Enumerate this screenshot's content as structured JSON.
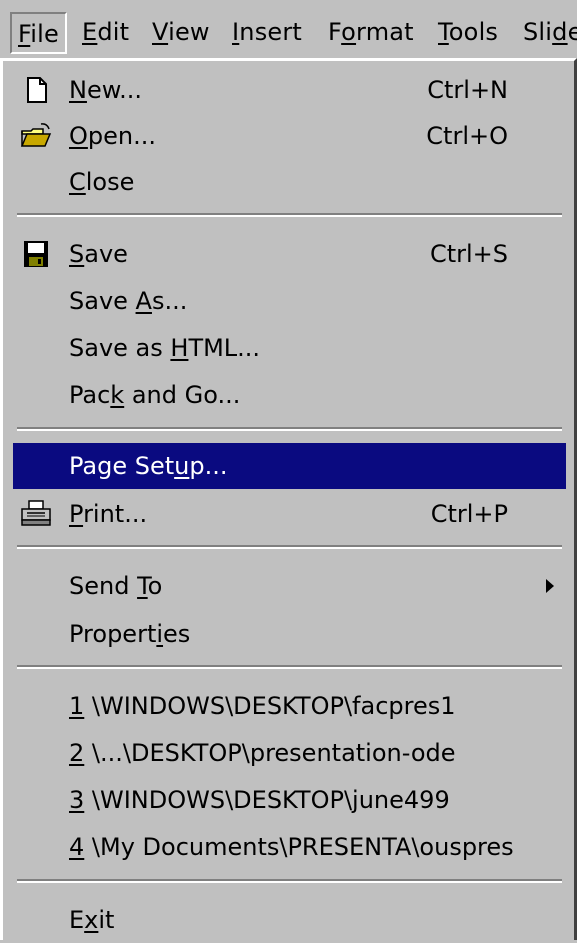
{
  "menubar": {
    "items": [
      {
        "pre": "",
        "u": "F",
        "post": "ile"
      },
      {
        "pre": "",
        "u": "E",
        "post": "dit"
      },
      {
        "pre": "",
        "u": "V",
        "post": "iew"
      },
      {
        "pre": "",
        "u": "I",
        "post": "nsert"
      },
      {
        "pre": "F",
        "u": "o",
        "post": "rmat"
      },
      {
        "pre": "",
        "u": "T",
        "post": "ools"
      },
      {
        "pre": "Sli",
        "u": "d",
        "post": "e"
      }
    ]
  },
  "menu": {
    "new": {
      "pre": "",
      "u": "N",
      "post": "ew...",
      "shortcut": "Ctrl+N"
    },
    "open": {
      "pre": "",
      "u": "O",
      "post": "pen...",
      "shortcut": "Ctrl+O"
    },
    "close": {
      "pre": "",
      "u": "C",
      "post": "lose"
    },
    "save": {
      "pre": "",
      "u": "S",
      "post": "ave",
      "shortcut": "Ctrl+S"
    },
    "save_as": {
      "pre": "Save ",
      "u": "A",
      "post": "s..."
    },
    "save_html": {
      "pre": "Save as ",
      "u": "H",
      "post": "TML..."
    },
    "pack_go": {
      "pre": "Pac",
      "u": "k",
      "post": " and Go..."
    },
    "page_setup": {
      "pre": "Page Set",
      "u": "u",
      "post": "p..."
    },
    "print": {
      "pre": "",
      "u": "P",
      "post": "rint...",
      "shortcut": "Ctrl+P"
    },
    "send_to": {
      "pre": "Send ",
      "u": "T",
      "post": "o"
    },
    "properties": {
      "pre": "Propert",
      "u": "i",
      "post": "es"
    },
    "recent": [
      {
        "u": "1",
        "post": " \\WINDOWS\\DESKTOP\\facpres1"
      },
      {
        "u": "2",
        "post": " \\...\\DESKTOP\\presentation-ode"
      },
      {
        "u": "3",
        "post": " \\WINDOWS\\DESKTOP\\june499"
      },
      {
        "u": "4",
        "post": " \\My Documents\\PRESENTA\\ouspres"
      }
    ],
    "exit": {
      "pre": "E",
      "u": "x",
      "post": "it"
    }
  },
  "colors": {
    "face": "#c0c0c0",
    "highlight": "#0a0a80"
  },
  "icons": {
    "new": "new-document-icon",
    "open": "open-folder-icon",
    "save": "floppy-disk-icon",
    "print": "printer-icon",
    "send_to": "submenu-arrow-icon"
  }
}
